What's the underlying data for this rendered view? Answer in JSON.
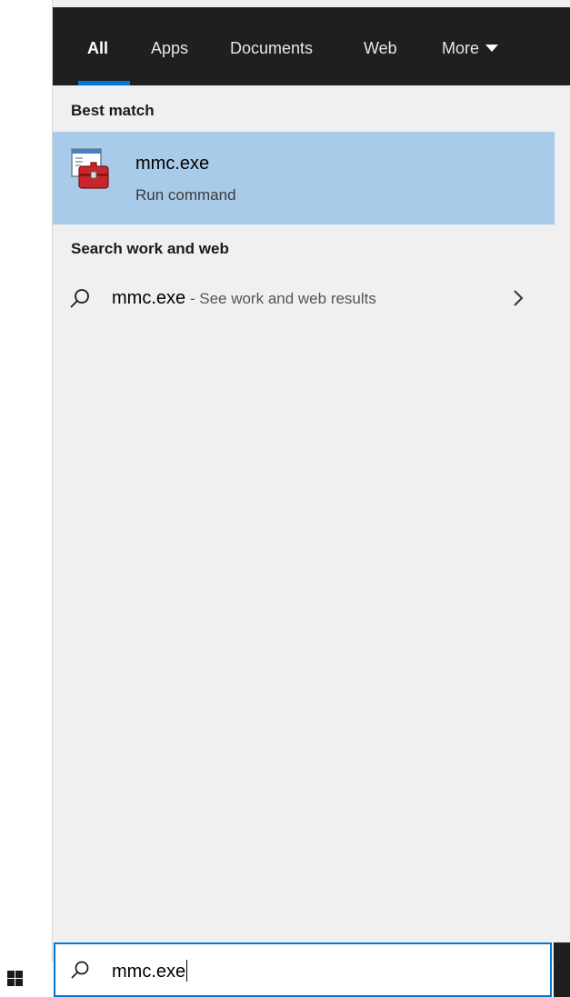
{
  "tabs": [
    {
      "label": "All",
      "active": true
    },
    {
      "label": "Apps",
      "active": false
    },
    {
      "label": "Documents",
      "active": false
    },
    {
      "label": "Web",
      "active": false
    },
    {
      "label": "More",
      "active": false
    }
  ],
  "best_match": {
    "heading": "Best match",
    "title": "mmc.exe",
    "subtitle": "Run command",
    "icon": "toolbox-icon"
  },
  "web_section": {
    "heading": "Search work and web",
    "query": "mmc.exe",
    "suffix": " - See work and web results",
    "icon": "search-icon"
  },
  "search_box": {
    "value": "mmc.exe",
    "icon": "search-icon"
  },
  "colors": {
    "accent": "#0078d7",
    "highlight": "#a8cbea",
    "tabbar": "#1f1f1f",
    "panel": "#f0f0f0"
  }
}
